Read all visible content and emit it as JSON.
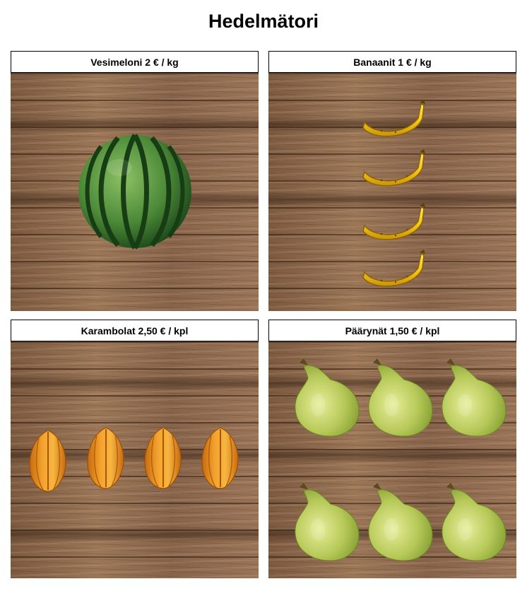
{
  "page": {
    "title": "Hedelmätori"
  },
  "stalls": [
    {
      "label": "Vesimeloni 2 € / kg",
      "fruit": "watermelon",
      "count": 1
    },
    {
      "label": "Banaanit 1 € / kg",
      "fruit": "banana",
      "count": 4
    },
    {
      "label": "Karambolat 2,50 € / kpl",
      "fruit": "star-fruit",
      "count": 4
    },
    {
      "label": "Päärynät 1,50 € / kpl",
      "fruit": "pear",
      "count": 6
    }
  ],
  "colors": {
    "wood": "#8a6548",
    "watermelon_green": "#2f6b2a",
    "banana_yellow": "#f2c418",
    "starfruit_orange": "#e8901c",
    "pear_green": "#b7c85a"
  }
}
